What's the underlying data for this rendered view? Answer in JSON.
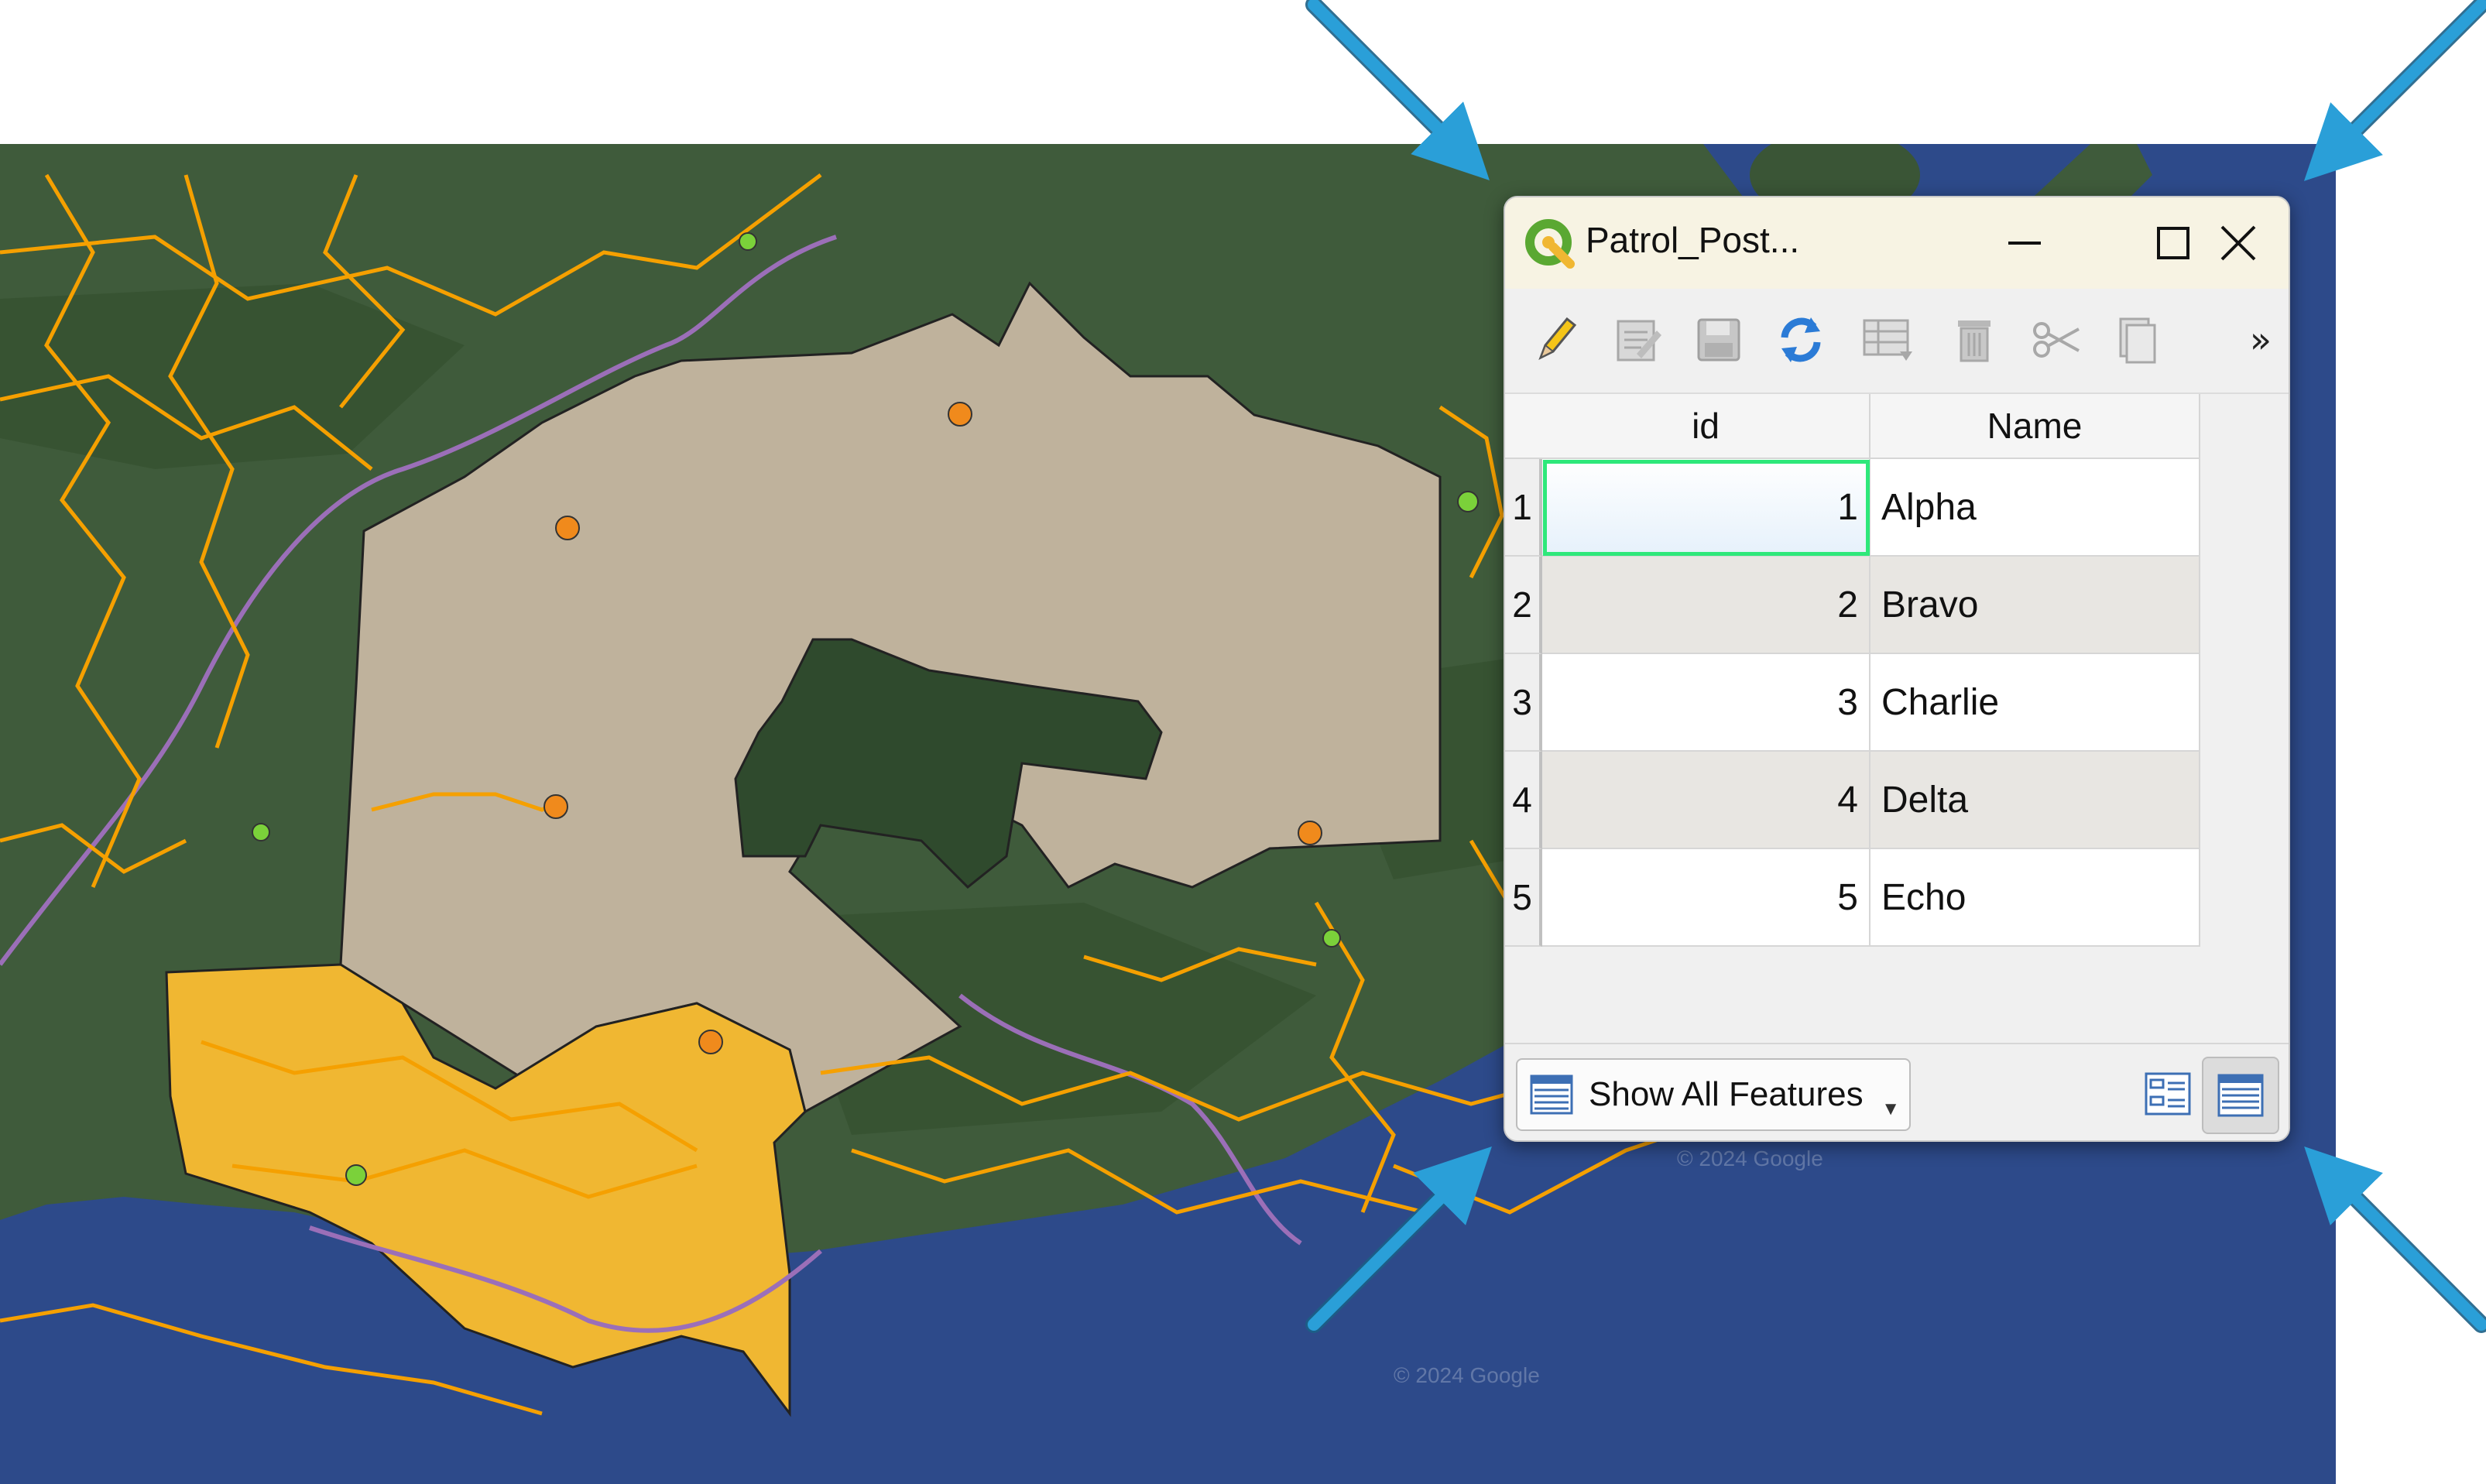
{
  "window": {
    "title": "Patrol_Post...",
    "minimize_label": "minimize",
    "maximize_label": "maximize",
    "close_label": "close"
  },
  "toolbar": {
    "items": [
      "pencil-icon",
      "edit-multiple-icon",
      "save-icon",
      "refresh-icon",
      "add-feature-icon",
      "delete-icon",
      "cut-icon",
      "copy-icon"
    ],
    "overflow_label": "»"
  },
  "table": {
    "columns": [
      "id",
      "Name"
    ],
    "rows": [
      {
        "num": "1",
        "id": "1",
        "name": "Alpha"
      },
      {
        "num": "2",
        "id": "2",
        "name": "Bravo"
      },
      {
        "num": "3",
        "id": "3",
        "name": "Charlie"
      },
      {
        "num": "4",
        "id": "4",
        "name": "Delta"
      },
      {
        "num": "5",
        "id": "5",
        "name": "Echo"
      }
    ],
    "selected_row": 1
  },
  "footer": {
    "filter_label": "Show All Features"
  },
  "map": {
    "watermark": "© 2024 Google",
    "colors": {
      "sea": "#2f4f8f",
      "land": "#3e5a3a",
      "protected_area": "#bfb29c",
      "yellow_area": "#f0b732",
      "roads": "#f5a000",
      "rivers": "#9b6fb8",
      "patrol_posts_orange": "#f08a1c",
      "patrol_posts_green": "#7bd13a"
    }
  },
  "annotation": {
    "arrow_color": "#2a9fd8"
  }
}
